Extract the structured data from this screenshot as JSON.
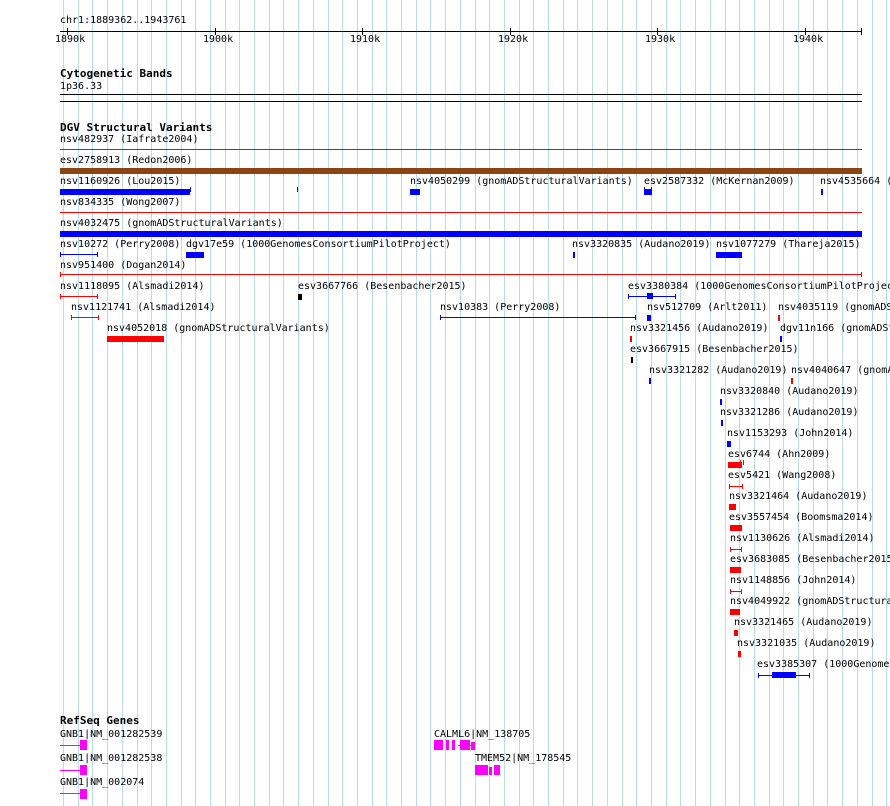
{
  "ruler": {
    "range": "chr1:1889362..1943761",
    "ticks": [
      "1890k",
      "1900k",
      "1910k",
      "1920k",
      "1930k",
      "1940k"
    ]
  },
  "cytoband": {
    "title": "Cytogenetic Bands",
    "band": "1p36.33"
  },
  "dgv": {
    "title": "DGV Structural Variants",
    "colors": {
      "loss": "#ff0000",
      "gain": "#0000ff",
      "both": "#8b4513",
      "other": "#000000"
    },
    "variants": [
      "nsv482937 (Iafrate2004)",
      "esv2758913 (Redon2006)",
      "nsv1160926 (Lou2015)",
      "nsv4050299 (gnomADStructuralVariants)",
      "esv2587332 (McKernan2009)",
      "nsv4535664 (",
      "nsv834335 (Wong2007)",
      "nsv4032475 (gnomADStructuralVariants)",
      "nsv10272 (Perry2008)",
      "dgv17e59 (1000GenomesConsortiumPilotProject)",
      "nsv3320835 (Audano2019)",
      "nsv1077279 (Thareja2015)",
      "nsv951400 (Dogan2014)",
      "nsv1118095 (Alsmadi2014)",
      "esv3667766 (Besenbacher2015)",
      "esv3380384 (1000GenomesConsortiumPilotProjec",
      "nsv1121741 (Alsmadi2014)",
      "nsv10383 (Perry2008)",
      "nsv512709 (Arlt2011)",
      "nsv4035119 (gnomADS",
      "nsv4052018 (gnomADStructuralVariants)",
      "nsv3321456 (Audano2019)",
      "dgv11n166 (gnomADSt",
      "esv3667915 (Besenbacher2015)",
      "nsv3321282 (Audano2019)",
      "nsv4040647 (gnomA",
      "nsv3320840 (Audano2019)",
      "nsv3321286 (Audano2019)",
      "nsv1153293 (John2014)",
      "esv6744 (Ahn2009)",
      "esv5421 (Wang2008)",
      "nsv3321464 (Audano2019)",
      "esv3557454 (Boomsma2014)",
      "nsv1130626 (Alsmadi2014)",
      "esv3683085 (Besenbacher2015",
      "nsv1148856 (John2014)",
      "nsv4049922 (gnomADStructura",
      "nsv3321465 (Audano2019)",
      "nsv3321035 (Audano2019)",
      "esv3385307 (1000Genomes"
    ]
  },
  "refseq": {
    "title": "RefSeq Genes",
    "color": "#ff00ff",
    "genes": [
      "GNB1|NM_001282539",
      "CALML6|NM_138705",
      "GNB1|NM_001282538",
      "TMEM52|NM_178545",
      "GNB1|NM_002074"
    ]
  }
}
